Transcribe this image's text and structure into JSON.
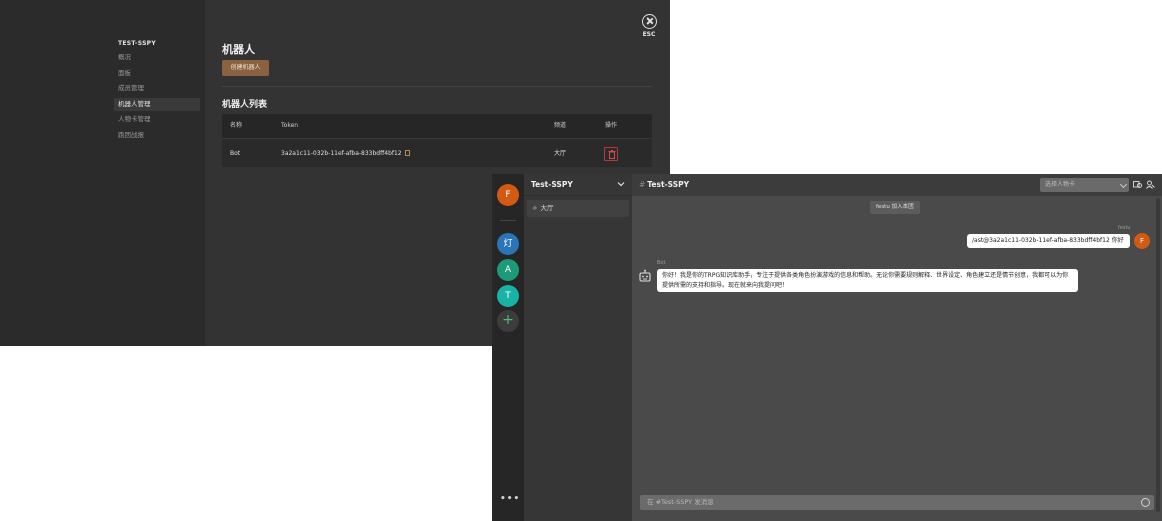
{
  "settings": {
    "sidebar": {
      "title": "TEST-SSPY",
      "items": [
        {
          "label": "概况",
          "active": false
        },
        {
          "label": "面板",
          "active": false
        },
        {
          "label": "成员管理",
          "active": false
        },
        {
          "label": "机器人管理",
          "active": true
        },
        {
          "label": "人物卡管理",
          "active": false
        },
        {
          "label": "跑团战报",
          "active": false
        }
      ]
    },
    "page_title": "机器人",
    "create_button": "创建机器人",
    "list_title": "机器人列表",
    "table": {
      "columns": [
        "名称",
        "Token",
        "频道",
        "操作"
      ],
      "rows": [
        {
          "name": "Bot",
          "token": "3a2a1c11-032b-11ef-afba-833bdff4bf12",
          "channel": "大厅"
        }
      ]
    },
    "esc_label": "ESC"
  },
  "chat": {
    "rail": {
      "user_initial": "F",
      "servers": [
        {
          "label": "灯",
          "color": "#2c74b8"
        },
        {
          "label": "A",
          "color": "#1d9a7a"
        },
        {
          "label": "T",
          "color": "#18b3a4"
        }
      ],
      "add_icon": "+",
      "more_icon": "•••"
    },
    "server_name": "Test-SSPY",
    "channels": [
      {
        "name": "大厅"
      }
    ],
    "topbar": {
      "channel_title": "Test-SSPY",
      "search_placeholder": "选择人物卡"
    },
    "messages": {
      "system": "festu 加入本团",
      "user_name": "festu",
      "user_message": "/ast@3a2a1c11-032b-11ef-afba-833bdff4bf12 你好",
      "user_initial": "F",
      "bot_name": "Bot",
      "bot_reply": "你好！我是你的TRPG知识库助手，专注于提供各类角色扮演游戏的信息和帮助。无论你需要规则解释、世界设定、角色建立还是情节创意，我都可以为你提供所需的支持和指导。现在就来向我提问吧！"
    },
    "input_placeholder": "在 #Test-SSPY 发消息",
    "colors": {
      "accent": "#d35a12",
      "button": "#8a6240",
      "danger": "#b23a3a"
    }
  }
}
